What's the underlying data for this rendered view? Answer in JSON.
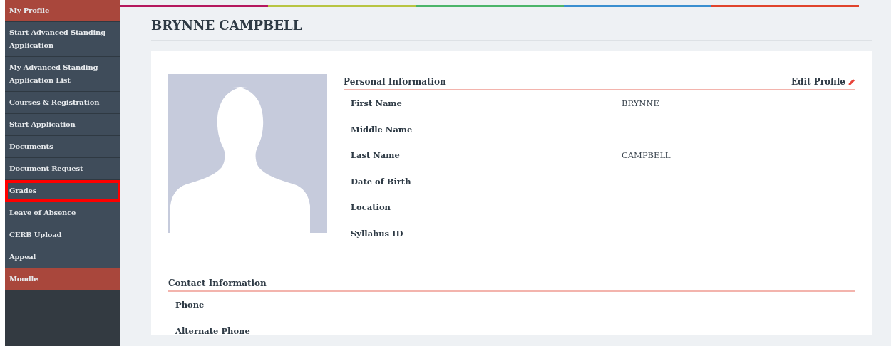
{
  "sidebar": {
    "items": [
      {
        "label": "My Profile",
        "kind": "accent",
        "highlighted": false
      },
      {
        "label": "Start Advanced Standing Application",
        "kind": "plain",
        "highlighted": false
      },
      {
        "label": "My Advanced Standing Application List",
        "kind": "plain",
        "highlighted": false
      },
      {
        "label": "Courses & Registration",
        "kind": "plain",
        "highlighted": false
      },
      {
        "label": "Start Application",
        "kind": "plain",
        "highlighted": false
      },
      {
        "label": "Documents",
        "kind": "plain",
        "highlighted": false
      },
      {
        "label": "Document Request",
        "kind": "plain",
        "highlighted": false
      },
      {
        "label": "Grades",
        "kind": "plain",
        "highlighted": true
      },
      {
        "label": "Leave of Absence",
        "kind": "plain",
        "highlighted": false
      },
      {
        "label": "CERB Upload",
        "kind": "plain",
        "highlighted": false
      },
      {
        "label": "Appeal",
        "kind": "plain",
        "highlighted": false
      },
      {
        "label": "Moodle",
        "kind": "accent",
        "highlighted": false
      }
    ]
  },
  "page": {
    "title": "BRYNNE CAMPBELL"
  },
  "profile": {
    "personal": {
      "heading": "Personal Information",
      "edit_link": "Edit Profile",
      "fields": [
        {
          "label": "First Name",
          "value": "BRYNNE"
        },
        {
          "label": "Middle Name"
        },
        {
          "label": "Last Name",
          "value": "CAMPBELL"
        },
        {
          "label": "Date of Birth"
        },
        {
          "label": "Location"
        },
        {
          "label": "Syllabus ID"
        }
      ]
    },
    "contact": {
      "heading": "Contact Information",
      "fields": [
        {
          "label": "Phone"
        },
        {
          "label": "Alternate Phone"
        }
      ]
    }
  }
}
